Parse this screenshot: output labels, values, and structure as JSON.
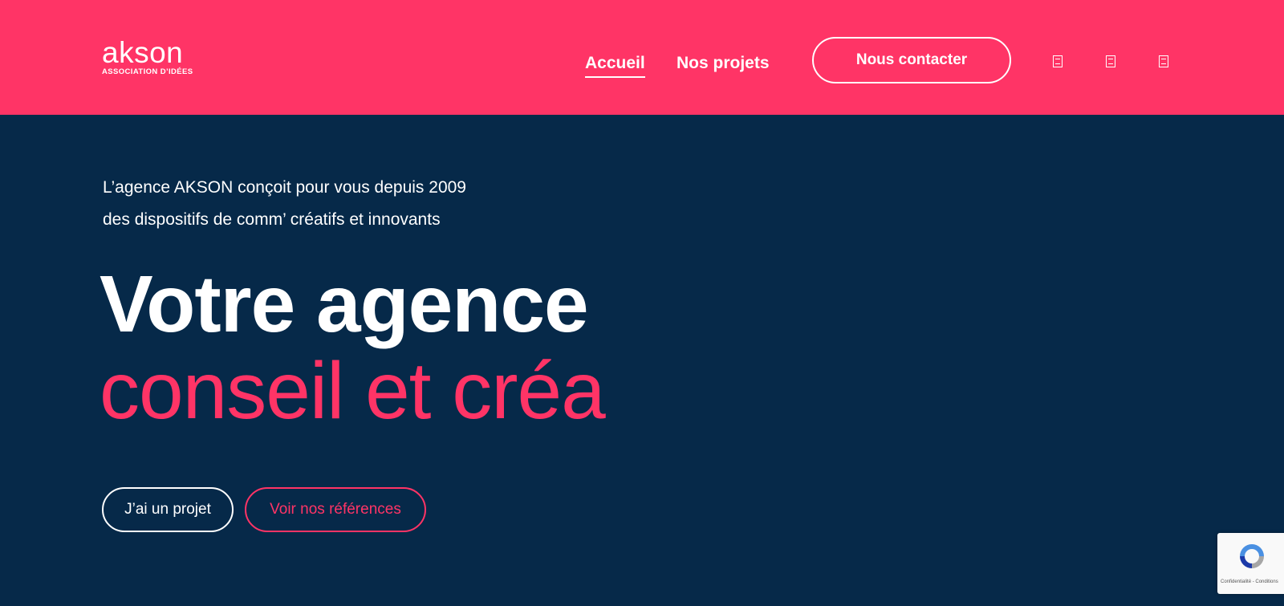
{
  "header": {
    "logo": {
      "wordmark": "akson",
      "tagline": "ASSOCIATION D’IDÉES"
    },
    "nav": [
      {
        "label": "Accueil",
        "active": true
      },
      {
        "label": "Nos projets",
        "active": false
      }
    ],
    "contact_label": "Nous contacter",
    "social_icons": [
      "social-icon-1",
      "social-icon-2",
      "social-icon-3"
    ]
  },
  "hero": {
    "intro_line1": "L’agence AKSON conçoit pour vous depuis 2009",
    "intro_line2": "des dispositifs de comm’ créatifs et innovants",
    "headline_line1": "Votre agence",
    "headline_line2": "conseil et créa",
    "cta_primary": "J’ai un projet",
    "cta_secondary": "Voir nos références"
  },
  "recaptcha": {
    "footer": "Confidentialité - Conditions"
  },
  "colors": {
    "brand_pink": "#ff3466",
    "navy": "#062949",
    "white": "#ffffff"
  }
}
